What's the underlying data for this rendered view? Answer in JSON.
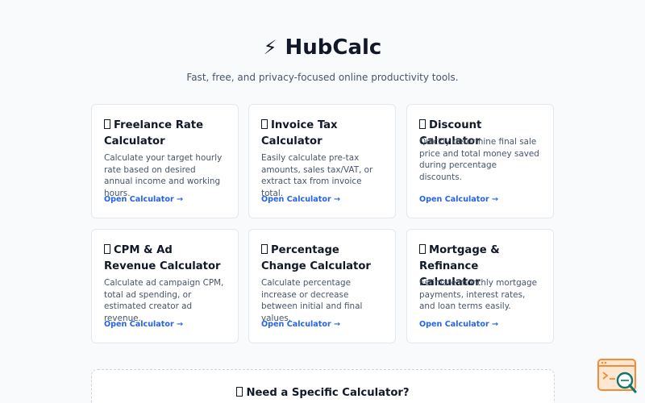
{
  "header": {
    "logo_icon": "⚡",
    "title": "HubCalc",
    "subtitle": "Fast, free, and privacy-focused online productivity tools."
  },
  "cards": [
    {
      "title": "Freelance Rate Calculator",
      "description": "Calculate your target hourly rate based on desired annual income and working hours.",
      "link": "Open Calculator →"
    },
    {
      "title": "Invoice Tax Calculator",
      "description": "Easily calculate pre-tax amounts, sales tax/VAT, or extract tax from invoice total.",
      "link": "Open Calculator →"
    },
    {
      "title": "Discount Calculator",
      "description": "Quickly determine final sale price and total money saved during percentage discounts.",
      "link": "Open Calculator →"
    },
    {
      "title": "CPM & Ad Revenue Calculator",
      "description": "Calculate ad campaign CPM, total ad spending, or estimated creator ad revenue.",
      "link": "Open Calculator →"
    },
    {
      "title": "Percentage Change Calculator",
      "description": "Calculate percentage increase or decrease between initial and final values.",
      "link": "Open Calculator →"
    },
    {
      "title": "Mortgage & Refinance Calculator",
      "description": "Estimate monthly mortgage payments, interest rates, and loan terms easily.",
      "link": "Open Calculator →"
    }
  ],
  "cta": {
    "title": "Need a Specific Calculator?"
  },
  "icons": {
    "card_icon": "missing-glyph-icon",
    "help_widget": "search-help-icon"
  },
  "colors": {
    "background": "#f8fafc",
    "link": "#2563eb",
    "widget_accent": "#f28c38"
  }
}
